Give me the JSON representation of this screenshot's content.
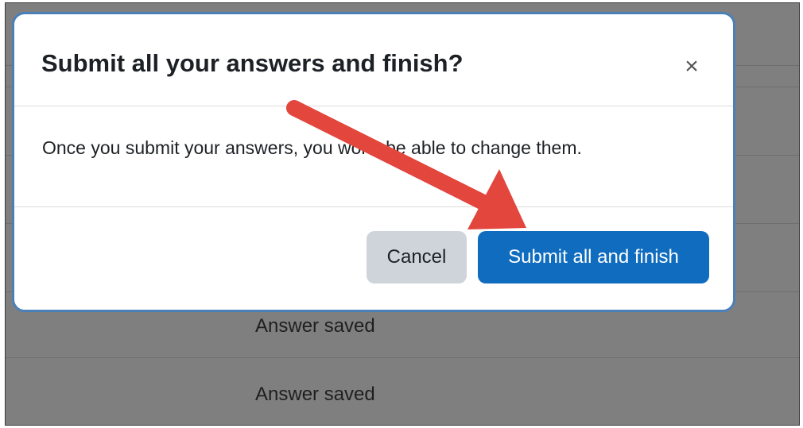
{
  "modal": {
    "title": "Submit all your answers and finish?",
    "close_symbol": "×",
    "message": "Once you submit your answers, you won’t be able to change them.",
    "cancel_label": "Cancel",
    "submit_label": "Submit all and finish"
  },
  "background_rows": [
    {
      "status": "Answer saved"
    },
    {
      "status": "Answer saved"
    }
  ],
  "colors": {
    "primary": "#0f6cbf",
    "secondary": "#ced4da",
    "arrow": "#e2463c",
    "backdrop": "#7f7f7f"
  },
  "icons": {
    "close": "close-icon",
    "annotation": "red-arrow-icon"
  }
}
